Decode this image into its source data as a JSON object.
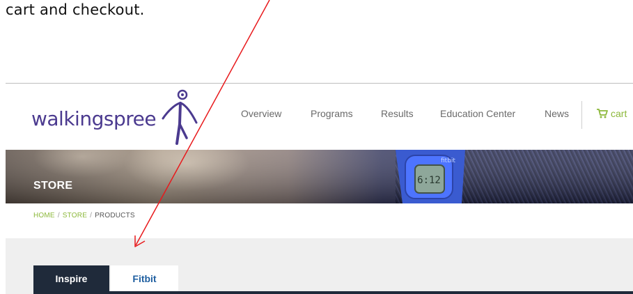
{
  "instruction": {
    "text": "cart and checkout."
  },
  "header": {
    "logo_text": "walkingspree",
    "nav": [
      {
        "label": "Overview"
      },
      {
        "label": "Programs"
      },
      {
        "label": "Results"
      },
      {
        "label": "Education Center"
      },
      {
        "label": "News"
      }
    ],
    "cart_label": "cart",
    "cart_icon": "cart-icon"
  },
  "banner": {
    "title": "STORE",
    "device_brand": "fitbit",
    "device_display": "6:12"
  },
  "breadcrumb": {
    "items": [
      {
        "label": "HOME"
      },
      {
        "label": "STORE"
      },
      {
        "label": "PRODUCTS"
      }
    ],
    "separator": "/"
  },
  "tabs": [
    {
      "label": "Inspire",
      "active": true
    },
    {
      "label": "Fitbit",
      "active": false
    }
  ],
  "colors": {
    "brand_purple": "#4b3a8f",
    "accent_green": "#8cb83a",
    "tab_dark": "#1f2a3a",
    "tab_link_blue": "#1f5fa0",
    "annotation_red": "#e8191c"
  }
}
